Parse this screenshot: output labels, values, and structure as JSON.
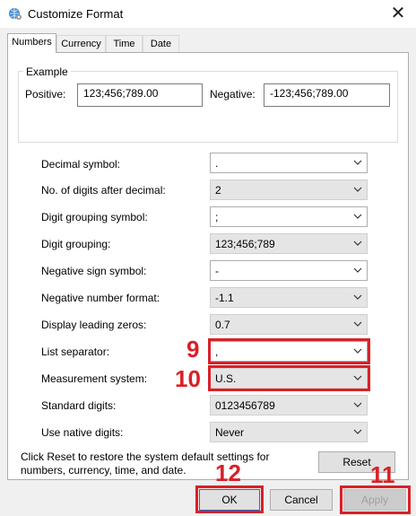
{
  "window": {
    "title": "Customize Format"
  },
  "tabs": [
    "Numbers",
    "Currency",
    "Time",
    "Date"
  ],
  "example": {
    "legend": "Example",
    "positive_label": "Positive:",
    "positive_value": "123;456;789.00",
    "negative_label": "Negative:",
    "negative_value": "-123;456;789.00"
  },
  "settings": [
    {
      "label": "Decimal symbol:",
      "value": "."
    },
    {
      "label": "No. of digits after decimal:",
      "value": "2"
    },
    {
      "label": "Digit grouping symbol:",
      "value": ";"
    },
    {
      "label": "Digit grouping:",
      "value": "123;456;789"
    },
    {
      "label": "Negative sign symbol:",
      "value": "-"
    },
    {
      "label": "Negative number format:",
      "value": "-1.1"
    },
    {
      "label": "Display leading zeros:",
      "value": "0.7"
    },
    {
      "label": "List separator:",
      "value": ","
    },
    {
      "label": "Measurement system:",
      "value": "U.S."
    },
    {
      "label": "Standard digits:",
      "value": "0123456789"
    },
    {
      "label": "Use native digits:",
      "value": "Never"
    }
  ],
  "footer": {
    "note": "Click Reset to restore the system default settings for numbers, currency, time, and date.",
    "reset": "Reset",
    "ok": "OK",
    "cancel": "Cancel",
    "apply": "Apply"
  },
  "annotations": {
    "n9": "9",
    "n10": "10",
    "n11": "11",
    "n12": "12",
    "color": "#d92027"
  },
  "icons": {
    "app": "globe-gear-icon",
    "close": "close-icon",
    "dropdown": "chevron-down-icon"
  }
}
